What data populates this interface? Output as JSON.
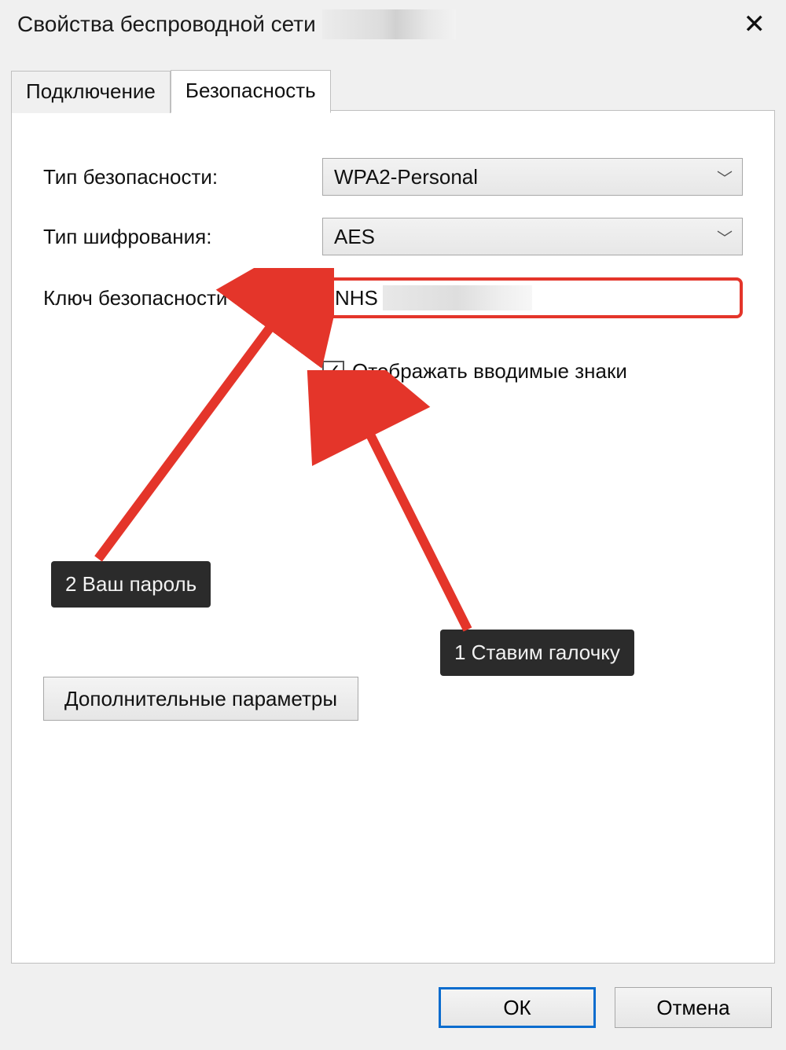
{
  "window": {
    "title": "Свойства беспроводной сети"
  },
  "tabs": {
    "connection": "Подключение",
    "security": "Безопасность"
  },
  "form": {
    "security_type_label": "Тип безопасности:",
    "security_type_value": "WPA2-Personal",
    "encryption_label": "Тип шифрования:",
    "encryption_value": "AES",
    "key_label": "Ключ безопасности сети",
    "key_value_visible": "NHS",
    "show_chars_label": "Отображать вводимые знаки"
  },
  "advanced_button": "Дополнительные параметры",
  "buttons": {
    "ok": "ОК",
    "cancel": "Отмена"
  },
  "annotations": {
    "step1": "1 Ставим галочку",
    "step2": "2 Ваш пароль"
  }
}
